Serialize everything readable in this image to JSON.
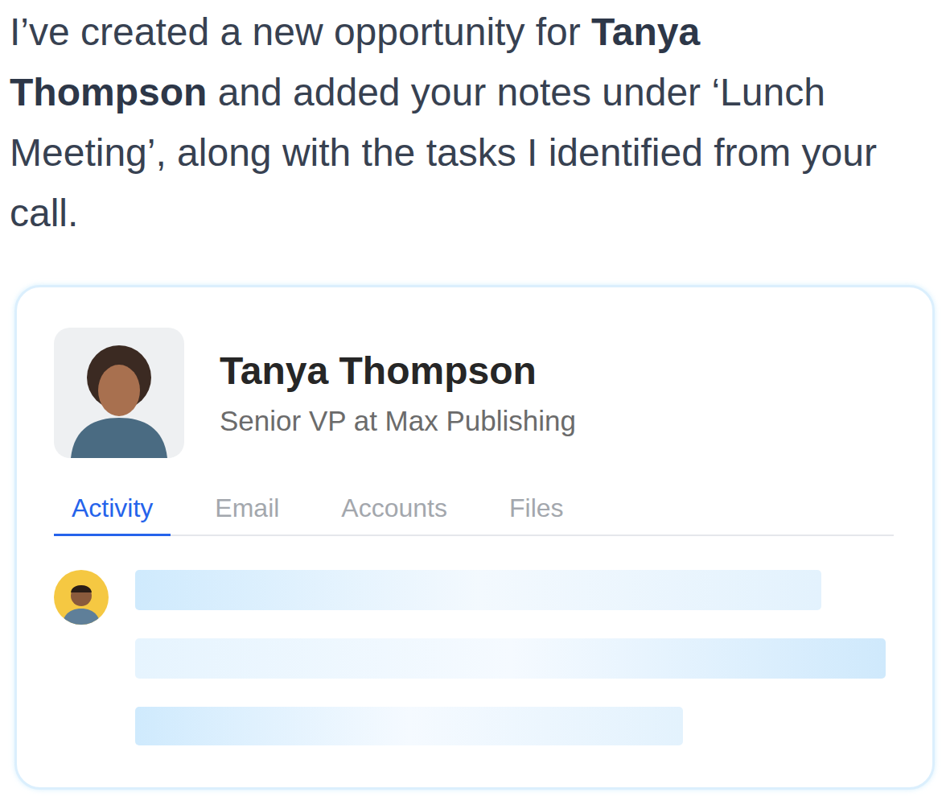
{
  "message": [
    {
      "text": "I’ve created a new opportunity for ",
      "bold": false
    },
    {
      "text": "Tanya Thompson",
      "bold": true
    },
    {
      "text": " and added your notes under ‘Lunch Meeting’, along with the tasks I identified from your call.",
      "bold": false
    }
  ],
  "contact": {
    "name": "Tanya Thompson",
    "title": "Senior VP at Max Publishing"
  },
  "tabs": [
    {
      "label": "Activity",
      "selected": true
    },
    {
      "label": "Email",
      "selected": false
    },
    {
      "label": "Accounts",
      "selected": false
    },
    {
      "label": "Files",
      "selected": false
    }
  ]
}
